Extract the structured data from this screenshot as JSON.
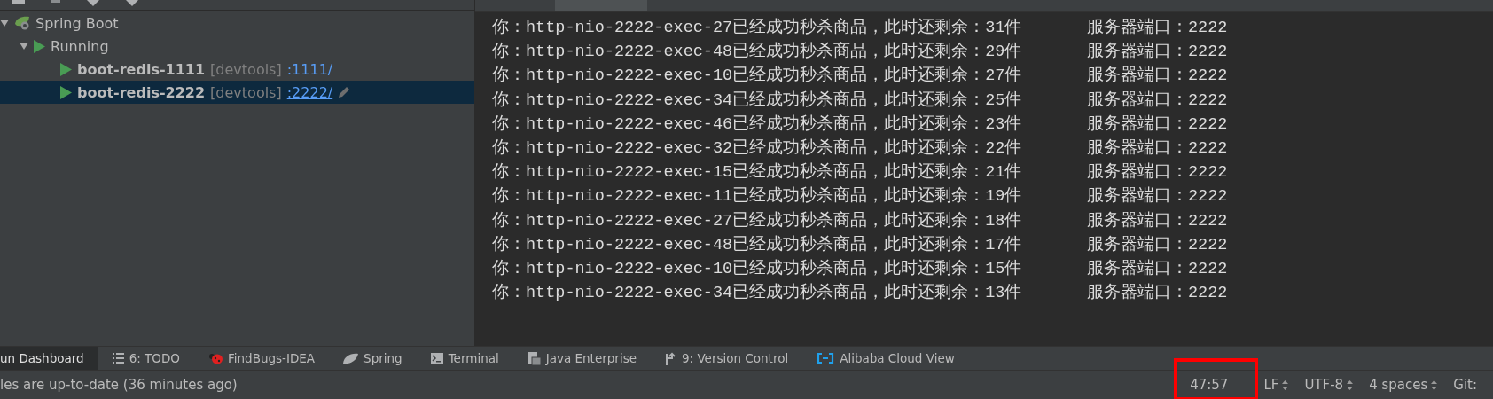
{
  "run_dashboard": {
    "tree": [
      {
        "label": "Spring Boot",
        "kind": "group",
        "expanded": true,
        "children": [
          {
            "label": "Running",
            "kind": "status",
            "expanded": true,
            "children": [
              {
                "label": "boot-redis-1111",
                "kind": "app",
                "tag": "[devtools]",
                "link": ":1111/",
                "selected": false
              },
              {
                "label": "boot-redis-2222",
                "kind": "app",
                "tag": "[devtools]",
                "link": ":2222/",
                "selected": true
              }
            ]
          }
        ]
      }
    ]
  },
  "console": {
    "lines": [
      {
        "message": "你：http-nio-2222-exec-27已经成功秒杀商品，此时还剩余：31件",
        "port": "服务器端口：2222"
      },
      {
        "message": "你：http-nio-2222-exec-48已经成功秒杀商品，此时还剩余：29件",
        "port": "服务器端口：2222"
      },
      {
        "message": "你：http-nio-2222-exec-10已经成功秒杀商品，此时还剩余：27件",
        "port": "服务器端口：2222"
      },
      {
        "message": "你：http-nio-2222-exec-34已经成功秒杀商品，此时还剩余：25件",
        "port": "服务器端口：2222"
      },
      {
        "message": "你：http-nio-2222-exec-46已经成功秒杀商品，此时还剩余：23件",
        "port": "服务器端口：2222"
      },
      {
        "message": "你：http-nio-2222-exec-32已经成功秒杀商品，此时还剩余：22件",
        "port": "服务器端口：2222"
      },
      {
        "message": "你：http-nio-2222-exec-15已经成功秒杀商品，此时还剩余：21件",
        "port": "服务器端口：2222"
      },
      {
        "message": "你：http-nio-2222-exec-11已经成功秒杀商品，此时还剩余：19件",
        "port": "服务器端口：2222"
      },
      {
        "message": "你：http-nio-2222-exec-27已经成功秒杀商品，此时还剩余：18件",
        "port": "服务器端口：2222"
      },
      {
        "message": "你：http-nio-2222-exec-48已经成功秒杀商品，此时还剩余：17件",
        "port": "服务器端口：2222"
      },
      {
        "message": "你：http-nio-2222-exec-10已经成功秒杀商品，此时还剩余：15件",
        "port": "服务器端口：2222"
      },
      {
        "message": "你：http-nio-2222-exec-34已经成功秒杀商品，此时还剩余：13件",
        "port": "服务器端口：2222"
      }
    ]
  },
  "tool_tabs": [
    {
      "kind": "dashboard",
      "label": "un Dashboard",
      "selected": true
    },
    {
      "kind": "todo",
      "mnemonic": "6",
      "label": ": TODO",
      "selected": false
    },
    {
      "kind": "bug",
      "label": "FindBugs-IDEA",
      "selected": false
    },
    {
      "kind": "leaf",
      "label": "Spring",
      "selected": false
    },
    {
      "kind": "terminal",
      "label": "Terminal",
      "selected": false
    },
    {
      "kind": "enterprise",
      "label": "Java Enterprise",
      "selected": false
    },
    {
      "kind": "vcs",
      "mnemonic": "9",
      "label": ": Version Control",
      "selected": false
    },
    {
      "kind": "cloud",
      "label": "Alibaba Cloud View",
      "selected": false
    }
  ],
  "status_bar": {
    "message": "les are up-to-date (36 minutes ago)",
    "items": [
      {
        "label": "47:57",
        "dropdown": false,
        "highlighted": true
      },
      {
        "label": "LF",
        "dropdown": true,
        "highlighted": false
      },
      {
        "label": "UTF-8",
        "dropdown": true,
        "highlighted": false
      },
      {
        "label": "4 spaces",
        "dropdown": true,
        "highlighted": false
      },
      {
        "label": "Git:",
        "dropdown": false,
        "highlighted": false
      }
    ]
  }
}
